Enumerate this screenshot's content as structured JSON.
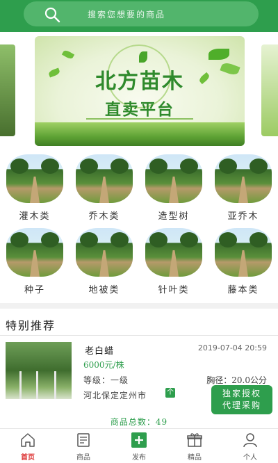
{
  "search": {
    "placeholder": "搜索您想要的商品",
    "icon": "search-icon"
  },
  "banner": {
    "title_line1": "北方苗木",
    "title_line2": "直卖平台"
  },
  "categories": [
    {
      "label": "灌木类"
    },
    {
      "label": "乔木类"
    },
    {
      "label": "造型树"
    },
    {
      "label": "亚乔木"
    },
    {
      "label": "种子"
    },
    {
      "label": "地被类"
    },
    {
      "label": "针叶类"
    },
    {
      "label": "藤本类"
    }
  ],
  "section": {
    "title": "特别推荐"
  },
  "product": {
    "name": "老白蜡",
    "date": "2019-07-04 20:59",
    "price": "6000元/株",
    "grade": "等级：一级",
    "diameter": "胸径：20.0公分",
    "location": "河北保定定州市",
    "badge": "个"
  },
  "promo": {
    "line1": "独家授权",
    "line2": "代理采购"
  },
  "total": {
    "text": "商品总数：49"
  },
  "tabs": [
    {
      "label": "首页",
      "icon": "home-icon",
      "active": true
    },
    {
      "label": "商品",
      "icon": "goods-icon",
      "active": false
    },
    {
      "label": "发布",
      "icon": "plus-icon",
      "active": false
    },
    {
      "label": "精品",
      "icon": "gift-icon",
      "active": false
    },
    {
      "label": "个人",
      "icon": "person-icon",
      "active": false
    }
  ],
  "colors": {
    "brand": "#2e9e4d",
    "active_tab": "#d33333"
  }
}
